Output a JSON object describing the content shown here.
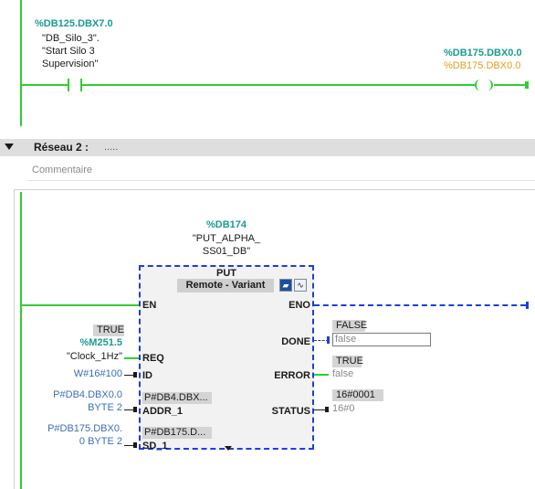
{
  "network1": {
    "contact_address": "%DB125.DBX7.0",
    "contact_symbol": "\"DB_Silo_3\".",
    "contact_comment_1": "\"Start Silo 3",
    "contact_comment_2": "Supervision\"",
    "coil_address": "%DB175.DBX0.0",
    "coil_address_status": "%DB175.DBX0.0"
  },
  "network2": {
    "header_title": "Réseau 2 :",
    "header_dots": ".....",
    "comment_placeholder": "Commentaire",
    "instance_address": "%DB174",
    "instance_name_1": "\"PUT_ALPHA_",
    "instance_name_2": "SS01_DB\"",
    "block": {
      "title": "PUT",
      "subtitle": "Remote - Variant",
      "pins_in": {
        "en": "EN",
        "req": "REQ",
        "id": "ID",
        "addr_1": "ADDR_1",
        "sd_1": "SD_1",
        "addr_1_inner": "P#DB4.DBX...",
        "sd_1_inner": "P#DB175.D..."
      },
      "pins_out": {
        "eno": "ENO",
        "done": "DONE",
        "error": "ERROR",
        "status": "STATUS"
      }
    },
    "req_status": "TRUE",
    "req_address": "%M251.5",
    "req_symbol": "\"Clock_1Hz\"",
    "id_value": "W#16#100",
    "addr_line1": "P#DB4.DBX0.0",
    "addr_line2": "BYTE 2",
    "sd_line1": "P#DB175.DBX0.",
    "sd_line2": "0 BYTE 2",
    "done_status": "FALSE",
    "done_value": "false",
    "error_status": "TRUE",
    "error_value": "false",
    "status_status": "16#0001",
    "status_value": "16#0"
  }
}
